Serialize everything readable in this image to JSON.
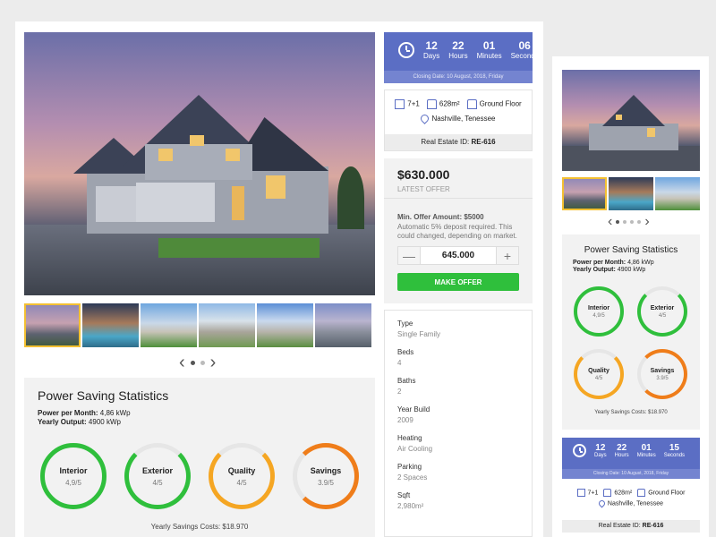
{
  "main": {
    "hero_alt": "house-photo",
    "thumbs": [
      "thumb-1",
      "thumb-2",
      "thumb-3",
      "thumb-4",
      "thumb-5",
      "thumb-6"
    ],
    "timer": {
      "days": "12",
      "hours": "22",
      "minutes": "01",
      "seconds": "06",
      "days_label": "Days",
      "hours_label": "Hours",
      "minutes_label": "Minutes",
      "seconds_label": "Seconds",
      "closing": "Closing Date: 10 August, 2018, Friday"
    },
    "info": {
      "rooms": "7+1",
      "area": "628m²",
      "floor": "Ground Floor",
      "location": "Nashville, Tenessee",
      "id_label": "Real Estate ID:",
      "id": "RE-616"
    },
    "offer": {
      "price": "$630.000",
      "latest": "LATEST OFFER",
      "min_label": "Min. Offer Amount: $5000",
      "min_note": "Automatic 5% deposit required. This could changed, depending on market.",
      "amount": "645.000",
      "minus": "—",
      "plus": "+",
      "button": "MAKE OFFER"
    },
    "details": [
      {
        "label": "Type",
        "value": "Single Family"
      },
      {
        "label": "Beds",
        "value": "4"
      },
      {
        "label": "Baths",
        "value": "2"
      },
      {
        "label": "Year Build",
        "value": "2009"
      },
      {
        "label": "Heating",
        "value": "Air Cooling"
      },
      {
        "label": "Parking",
        "value": "2 Spaces"
      },
      {
        "label": "Sqft",
        "value": "2,980m²"
      }
    ],
    "stats": {
      "title": "Power Saving Statistics",
      "month_label": "Power per Month:",
      "month_value": "4,86 kWp",
      "year_label": "Yearly Output:",
      "year_value": "4900 kWp",
      "rings": [
        {
          "label": "Interior",
          "value": "4,9/5",
          "color": "#2fbf3c"
        },
        {
          "label": "Exterior",
          "value": "4/5",
          "color": "#2fbf3c"
        },
        {
          "label": "Quality",
          "value": "4/5",
          "color": "#f5a623"
        },
        {
          "label": "Savings",
          "value": "3.9/5",
          "color": "#ef7d1a"
        }
      ],
      "yearly": "Yearly Savings Costs: $18.970"
    }
  },
  "side": {
    "stats": {
      "title": "Power Saving Statistics",
      "month_label": "Power per Month:",
      "month_value": "4,86 kWp",
      "year_label": "Yearly Output:",
      "year_value": "4900 kWp",
      "rings": [
        {
          "label": "Interior",
          "value": "4,9/5"
        },
        {
          "label": "Exterior",
          "value": "4/5"
        },
        {
          "label": "Quality",
          "value": "4/5"
        },
        {
          "label": "Savings",
          "value": "3.9/5"
        }
      ],
      "yearly": "Yearly Savings Costs: $18.970"
    },
    "timer": {
      "days": "12",
      "hours": "22",
      "minutes": "01",
      "seconds": "15",
      "days_label": "Days",
      "hours_label": "Hours",
      "minutes_label": "Minutes",
      "seconds_label": "Seconds",
      "closing": "Closing Date: 10 August, 2018, Friday"
    },
    "info": {
      "rooms": "7+1",
      "area": "628m²",
      "floor": "Ground Floor",
      "location": "Nashville, Tenessee",
      "id_label": "Real Estate ID:",
      "id": "RE-616"
    }
  },
  "colors": {
    "accent": "#5b6ec4",
    "green": "#2fbf3c",
    "orange": "#f5a623",
    "dark_orange": "#ef7d1a"
  }
}
